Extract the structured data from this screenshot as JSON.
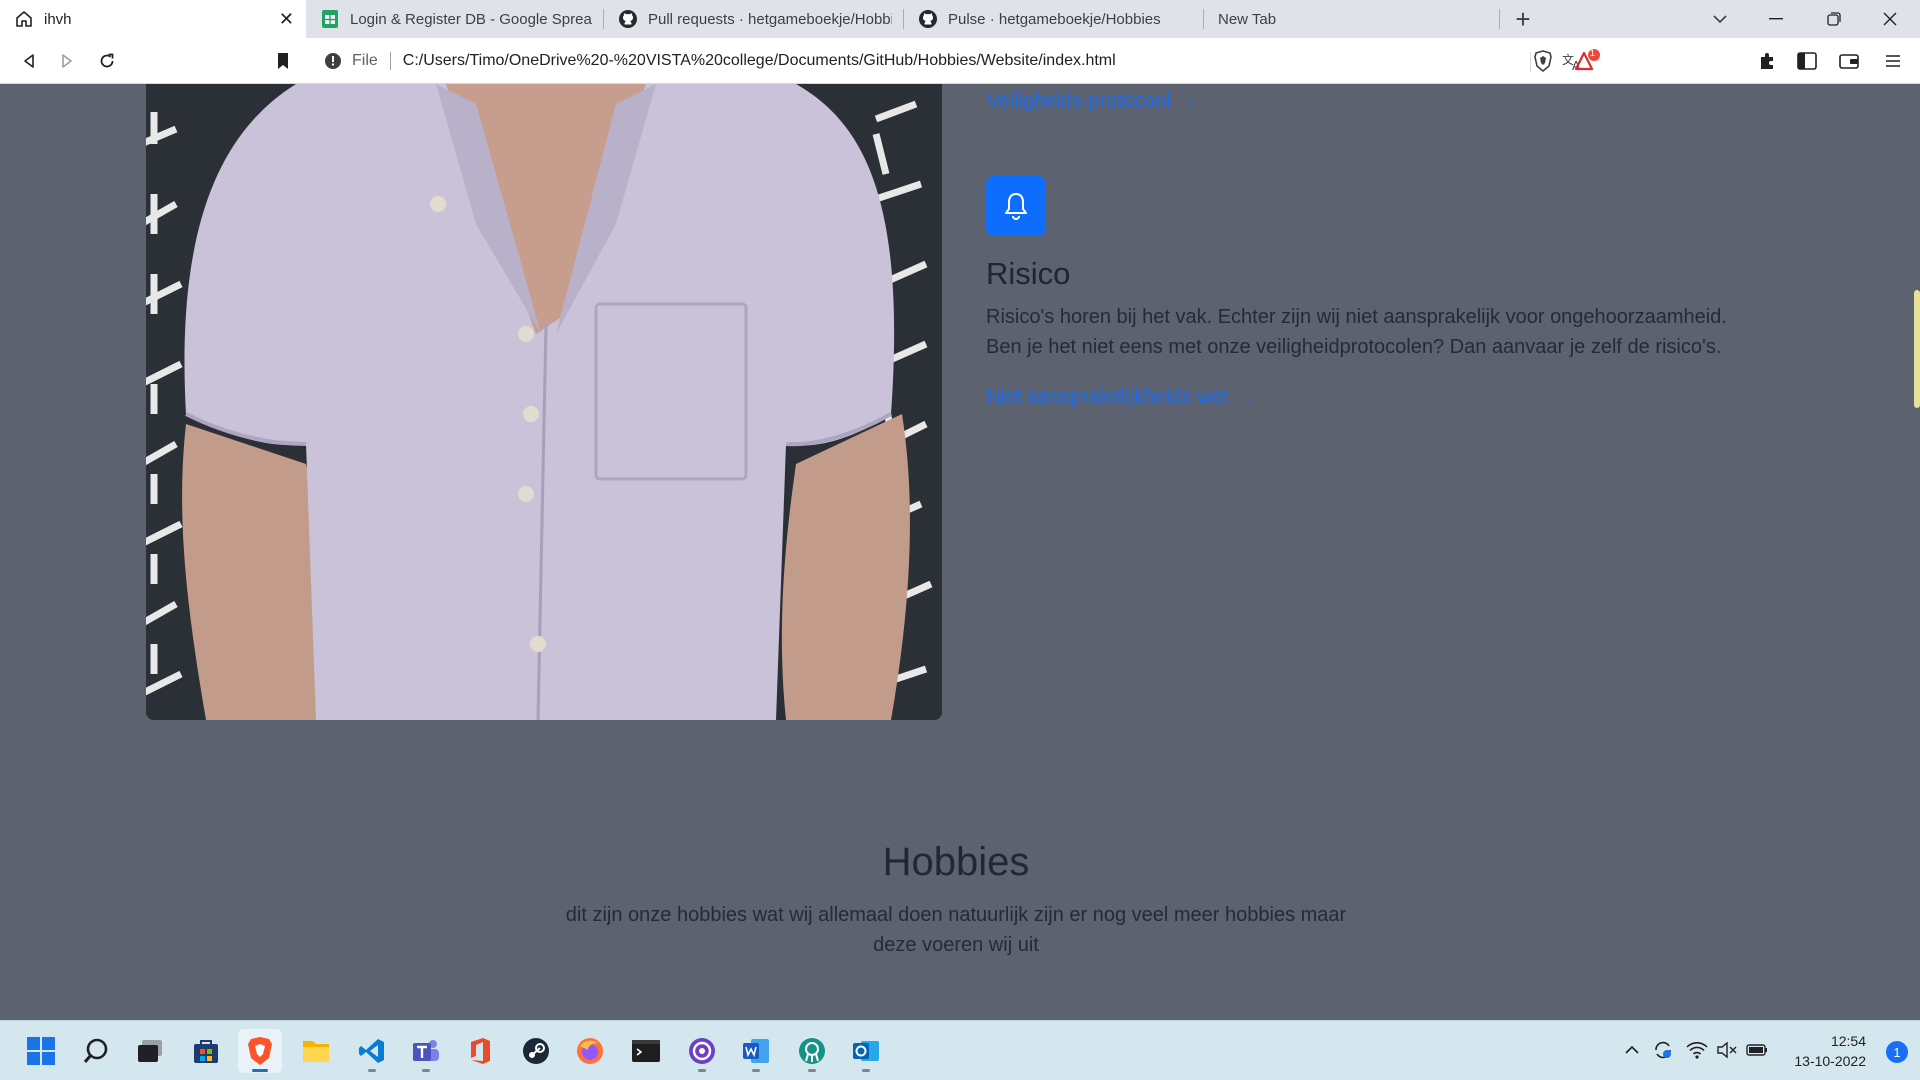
{
  "browser": {
    "tabs": [
      {
        "title": "ihvh",
        "icon": "home-icon",
        "active": true
      },
      {
        "title": "Login & Register DB - Google Spreadsheets",
        "icon": "google-sheets-icon",
        "active": false
      },
      {
        "title": "Pull requests · hetgameboekje/Hobbies",
        "icon": "github-icon",
        "active": false
      },
      {
        "title": "Pulse · hetgameboekje/Hobbies",
        "icon": "github-icon",
        "active": false
      },
      {
        "title": "New Tab",
        "icon": "",
        "active": false
      }
    ],
    "address": {
      "scheme_label": "File",
      "url": "C:/Users/Timo/OneDrive%20-%20VISTA%20college/Documents/GitHub/Hobbies/Website/index.html"
    },
    "brave_alert_count": "1"
  },
  "page": {
    "link_veiligheid": "Veiligheids-protocool →",
    "risico": {
      "icon": "bell-icon",
      "heading": "Risico",
      "text": "Risico's horen bij het vak. Echter zijn wij niet aansprakelijk voor ongehoorzaamheid. Ben je het niet eens met onze veiligheidprotocolen? Dan aanvaar je zelf de risico's.",
      "link": "Niet aansprakelijkheids wet →"
    },
    "hobbies": {
      "heading": "Hobbies",
      "text": "dit zijn onze hobbies wat wij allemaal doen natuurlijk zijn er nog veel meer hobbies maar deze voeren wij uit"
    },
    "accent_color": "#0d6efd",
    "background_color": "#5c6270"
  },
  "taskbar": {
    "apps": [
      "start-icon",
      "search-icon",
      "task-view-icon",
      "microsoft-store-icon",
      "brave-icon",
      "file-explorer-icon",
      "vscode-icon",
      "teams-icon",
      "office-icon",
      "steam-icon",
      "firefox-icon",
      "terminal-icon",
      "github-desktop-icon",
      "word-icon",
      "gitkraken-icon",
      "outlook-icon"
    ],
    "time": "12:54",
    "date": "13-10-2022",
    "notification_count": "1"
  }
}
